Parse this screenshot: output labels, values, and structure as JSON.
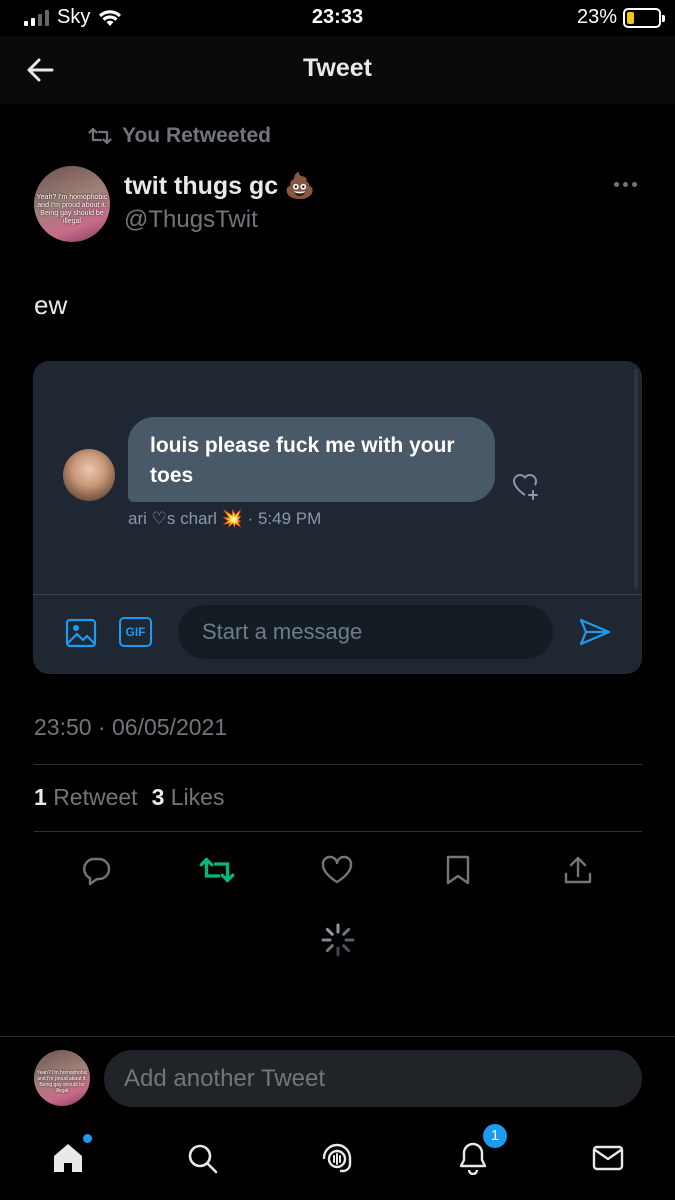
{
  "status_bar": {
    "carrier": "Sky",
    "time": "23:33",
    "battery_percent": "23%",
    "battery_level": 0.23
  },
  "header": {
    "title": "Tweet",
    "back_icon": "arrow-left-icon"
  },
  "retweet_context": {
    "label": "You Retweeted",
    "icon": "retweet-icon"
  },
  "author": {
    "name": "twit thugs gc",
    "emoji": "💩",
    "handle": "@ThugsTwit",
    "avatar_text": "Yeah? I'm homophobic and I'm proud about it. Being gay should be illegal"
  },
  "tweet": {
    "text": "ew",
    "timestamp": "23:50 · 06/05/2021",
    "retweets_count": "1",
    "retweets_label": "Retweet",
    "likes_count": "3",
    "likes_label": "Likes"
  },
  "embedded_dm": {
    "message": "louis please fuck me with your toes",
    "meta_name": "ari ♡s charl",
    "meta_emoji": "💥",
    "meta_time": "· 5:49 PM",
    "input_placeholder": "Start a message",
    "gif_label": "GIF"
  },
  "reply": {
    "placeholder": "Add another Tweet"
  },
  "tabbar": {
    "notifications_badge": "1"
  },
  "colors": {
    "accent": "#1d9bf0",
    "retweet_active": "#00ba7c",
    "muted": "#71767b",
    "card_bg": "#1e2732"
  }
}
